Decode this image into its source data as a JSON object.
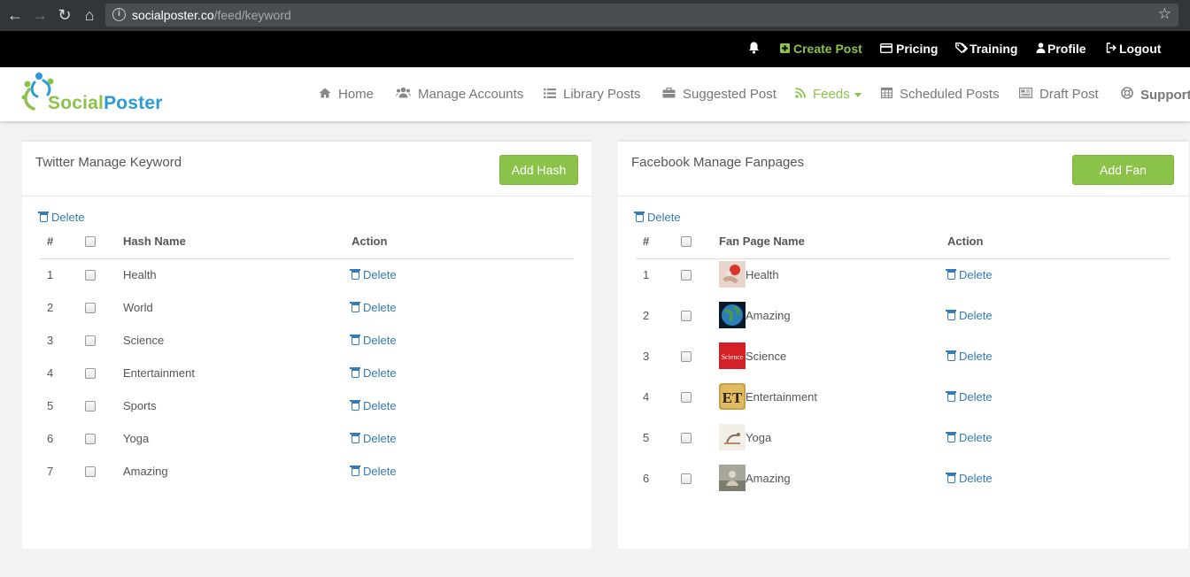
{
  "browser": {
    "url_host": "socialposter.co",
    "url_path": "/feed/keyword"
  },
  "topbar": {
    "create_post": "Create Post",
    "pricing": "Pricing",
    "training": "Training",
    "profile": "Profile",
    "logout": "Logout"
  },
  "logo": {
    "part1": "Social",
    "part2": "Poster"
  },
  "nav": {
    "home": "Home",
    "manage_accounts": "Manage Accounts",
    "library_posts": "Library Posts",
    "suggested_post": "Suggested Post",
    "feeds": "Feeds",
    "scheduled_posts": "Scheduled Posts",
    "draft_post": "Draft Post",
    "support": "Support"
  },
  "colors": {
    "accent": "#8bc34a",
    "link": "#337ab7",
    "brand_blue": "#2a9bd8"
  },
  "twitter": {
    "title": "Twitter Manage Keyword",
    "add_button": "Add Hash",
    "bulk_delete": "Delete",
    "col_num": "#",
    "col_name": "Hash Name",
    "col_action": "Action",
    "rows": [
      {
        "num": "1",
        "name": "Health",
        "action": "Delete"
      },
      {
        "num": "2",
        "name": "World",
        "action": "Delete"
      },
      {
        "num": "3",
        "name": "Science",
        "action": "Delete"
      },
      {
        "num": "4",
        "name": "Entertainment",
        "action": "Delete"
      },
      {
        "num": "5",
        "name": "Sports",
        "action": "Delete"
      },
      {
        "num": "6",
        "name": "Yoga",
        "action": "Delete"
      },
      {
        "num": "7",
        "name": "Amazing",
        "action": "Delete"
      }
    ]
  },
  "facebook": {
    "title": "Facebook Manage Fanpages",
    "add_button": "Add Fan Page",
    "bulk_delete": "Delete",
    "col_num": "#",
    "col_name": "Fan Page Name",
    "col_action": "Action",
    "rows": [
      {
        "num": "1",
        "name": "Health",
        "action": "Delete",
        "thumb": "health-thumb"
      },
      {
        "num": "2",
        "name": "Amazing",
        "action": "Delete",
        "thumb": "earth-thumb"
      },
      {
        "num": "3",
        "name": "Science",
        "action": "Delete",
        "thumb": "science-thumb",
        "thumb_text": "Science"
      },
      {
        "num": "4",
        "name": "Entertainment",
        "action": "Delete",
        "thumb": "et-thumb",
        "thumb_text": "ET"
      },
      {
        "num": "5",
        "name": "Yoga",
        "action": "Delete",
        "thumb": "yoga-thumb"
      },
      {
        "num": "6",
        "name": "Amazing",
        "action": "Delete",
        "thumb": "amazing-thumb"
      }
    ]
  }
}
